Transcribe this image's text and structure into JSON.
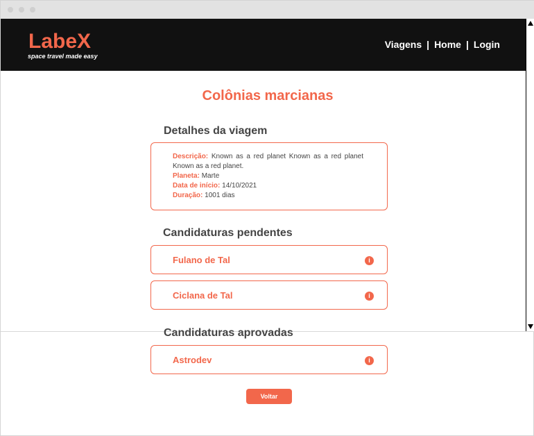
{
  "brand": {
    "name": "LabeX",
    "tagline": "space travel made easy",
    "accent_color": "#f2674b",
    "header_color": "#111111"
  },
  "nav": {
    "items": [
      "Viagens",
      "Home",
      "Login"
    ],
    "separator": "|"
  },
  "page": {
    "title": "Colônias marcianas"
  },
  "details": {
    "heading": "Detalhes da viagem",
    "description_label": "Descrição:",
    "description_value": "Known as a red planet Known as a red planet Known as a red planet.",
    "planet_label": "Planeta:",
    "planet_value": "Marte",
    "date_label": "Data de início:",
    "date_value": "14/10/2021",
    "duration_label": "Duração:",
    "duration_value": "1001 dias"
  },
  "pending": {
    "heading": "Candidaturas pendentes",
    "candidates": [
      "Fulano de Tal",
      "Ciclana de Tal"
    ]
  },
  "approved": {
    "heading": "Candidaturas aprovadas",
    "candidates": [
      "Astrodev"
    ]
  },
  "info_icon_glyph": "i",
  "back_button": {
    "label": "Voltar"
  }
}
